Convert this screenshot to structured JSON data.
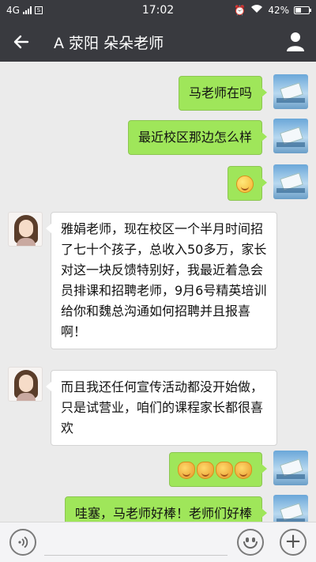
{
  "status_bar": {
    "network": "4G",
    "time": "17:02",
    "battery": "42%"
  },
  "header": {
    "back_icon": "arrow-left-icon",
    "title": "A 荥阳 朵朵老师",
    "profile_icon": "person-icon"
  },
  "messages": [
    {
      "from": "me",
      "text": "马老师在吗"
    },
    {
      "from": "me",
      "text": "最近校区那边怎么样"
    },
    {
      "from": "me",
      "emoji": "smile-emoji"
    },
    {
      "from": "her",
      "text": "雅娟老师，现在校区一个半月时间招了七十个孩子，总收入50多万，家长对这一块反馈特别好，我最近着急会员排课和招聘老师，9月6号精英培训给你和魏总沟通如何招聘并且报喜啊！"
    },
    {
      "from": "her",
      "text": "而且我还任何宣传活动都没开始做，只是试营业，咱们的课程家长都很喜欢"
    },
    {
      "from": "me",
      "emoji": "cheer-emoji ×4"
    },
    {
      "from": "me",
      "text": "哇塞，马老师好棒！老师们好棒"
    }
  ],
  "input_bar": {
    "voice_icon": "voice-icon",
    "emoji_icon": "emoji-icon",
    "plus_icon": "plus-icon"
  },
  "colors": {
    "header_bg": "#393a3f",
    "chat_bg": "#ebebeb",
    "my_bubble": "#9fe65a",
    "their_bubble": "#ffffff"
  }
}
